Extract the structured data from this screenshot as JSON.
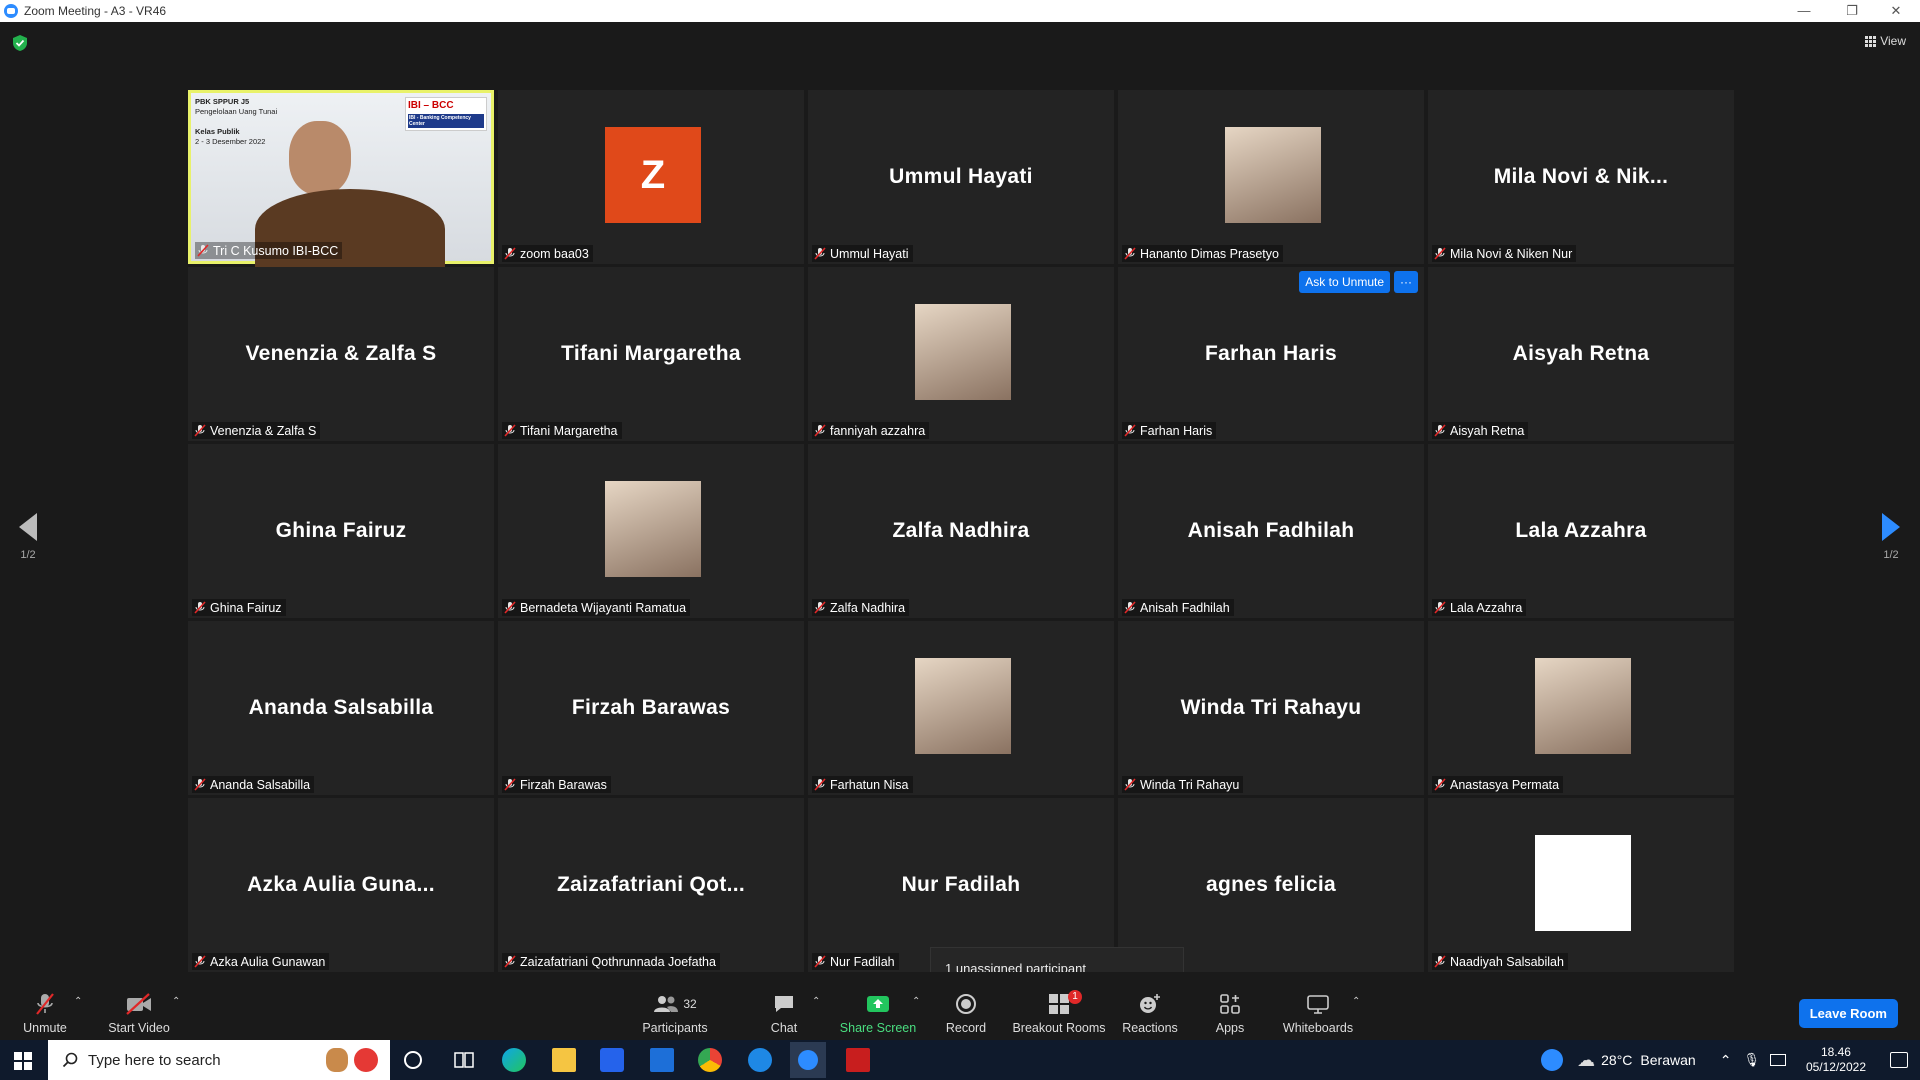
{
  "window": {
    "title": "Zoom Meeting - A3 - VR46",
    "controls": [
      "—",
      "❐",
      "✕"
    ]
  },
  "view_label": "View",
  "page_indicator": {
    "left": "1/2",
    "right": "1/2"
  },
  "presenter_slide": {
    "line1": "PBK SPPUR J5",
    "line2": "Pengelolaan Uang Tunai",
    "line3": "Kelas Publik",
    "line4": "2 - 3 Desember 2022",
    "logo1": "IBI",
    "logo2": "BCC",
    "logo_sub": "IBI - Banking Competency Center"
  },
  "ask_to_unmute": "Ask to Unmute",
  "more_dots": "···",
  "participants": [
    {
      "big": "",
      "name": "Tri C Kusumo IBI-BCC",
      "kind": "video"
    },
    {
      "big": "Z",
      "name": "zoom baa03",
      "kind": "letter"
    },
    {
      "big": "Ummul Hayati",
      "name": "Ummul Hayati",
      "kind": "text"
    },
    {
      "big": "",
      "name": "Hananto Dimas Prasetyo",
      "kind": "photo"
    },
    {
      "big": "Mila Novi & Nik...",
      "name": "Mila Novi & Niken Nur",
      "kind": "text"
    },
    {
      "big": "Venenzia & Zalfa S",
      "name": "Venenzia & Zalfa S",
      "kind": "text"
    },
    {
      "big": "Tifani Margaretha",
      "name": "Tifani Margaretha",
      "kind": "text"
    },
    {
      "big": "",
      "name": "fanniyah azzahra",
      "kind": "photo"
    },
    {
      "big": "Farhan Haris",
      "name": "Farhan Haris",
      "kind": "text"
    },
    {
      "big": "Aisyah Retna",
      "name": "Aisyah Retna",
      "kind": "text"
    },
    {
      "big": "Ghina Fairuz",
      "name": "Ghina Fairuz",
      "kind": "text"
    },
    {
      "big": "",
      "name": "Bernadeta Wijayanti Ramatua",
      "kind": "photo"
    },
    {
      "big": "Zalfa Nadhira",
      "name": "Zalfa Nadhira",
      "kind": "text"
    },
    {
      "big": "Anisah Fadhilah",
      "name": "Anisah Fadhilah",
      "kind": "text"
    },
    {
      "big": "Lala Azzahra",
      "name": "Lala Azzahra",
      "kind": "text"
    },
    {
      "big": "Ananda Salsabilla",
      "name": "Ananda Salsabilla",
      "kind": "text"
    },
    {
      "big": "Firzah Barawas",
      "name": "Firzah Barawas",
      "kind": "text"
    },
    {
      "big": "",
      "name": "Farhatun Nisa",
      "kind": "photo"
    },
    {
      "big": "Winda Tri Rahayu",
      "name": "Winda Tri Rahayu",
      "kind": "text"
    },
    {
      "big": "",
      "name": "Anastasya Permata",
      "kind": "photo"
    },
    {
      "big": "Azka Aulia Guna...",
      "name": "Azka Aulia Gunawan",
      "kind": "text"
    },
    {
      "big": "Zaizafatriani Qot...",
      "name": "Zaizafatriani Qothrunnada Joefatha",
      "kind": "text"
    },
    {
      "big": "Nur Fadilah",
      "name": "Nur Fadilah",
      "kind": "text"
    },
    {
      "big": "agnes felicia",
      "name": "elicia",
      "kind": "text"
    },
    {
      "big": "",
      "name": "Naadiyah Salsabilah",
      "kind": "blank"
    }
  ],
  "tooltip": "1 unassigned participant",
  "toolbar": {
    "unmute": "Unmute",
    "start_video": "Start Video",
    "participants": "Participants",
    "participants_count": "32",
    "chat": "Chat",
    "share_screen": "Share Screen",
    "record": "Record",
    "breakout_rooms": "Breakout Rooms",
    "breakout_badge": "1",
    "reactions": "Reactions",
    "apps": "Apps",
    "whiteboards": "Whiteboards",
    "leave": "Leave Room"
  },
  "taskbar": {
    "search_placeholder": "Type here to search",
    "weather_temp": "28°C",
    "weather_text": "Berawan",
    "time": "18.46",
    "date": "05/12/2022"
  },
  "colors": {
    "accent": "#0e72ed",
    "active_border": "#e9f26a",
    "zoom_avatar": "#e0491a",
    "share_green": "#22c55e"
  }
}
